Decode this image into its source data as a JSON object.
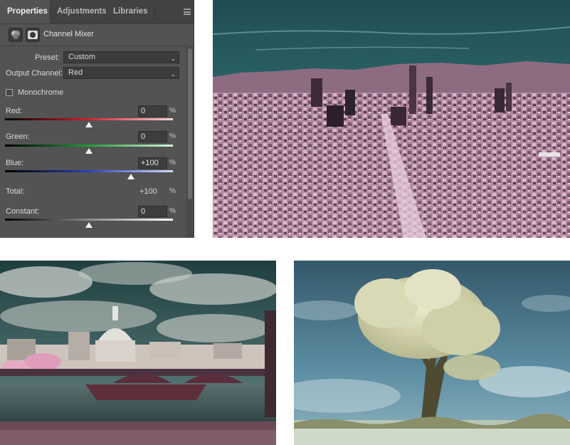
{
  "panel": {
    "tabs": [
      {
        "label": "Properties",
        "active": true
      },
      {
        "label": "Adjustments",
        "active": false
      },
      {
        "label": "Libraries",
        "active": false
      }
    ],
    "title": "Channel Mixer",
    "preset_label": "Preset:",
    "preset_value": "Custom",
    "output_channel_label": "Output Channel:",
    "output_channel_value": "Red",
    "monochrome_label": "Monochrome",
    "monochrome_checked": false,
    "sliders": [
      {
        "label": "Red:",
        "value": "0",
        "unit": "%",
        "level": 0
      },
      {
        "label": "Green:",
        "value": "0",
        "unit": "%",
        "level": 0
      },
      {
        "label": "Blue:",
        "value": "+100",
        "unit": "%",
        "level": 100
      }
    ],
    "total_label": "Total:",
    "total_value": "+100",
    "total_unit": "%",
    "constant": {
      "label": "Constant:",
      "value": "0",
      "unit": "%",
      "level": 0
    }
  },
  "photos": [
    {
      "name": "infrared-city-skyline",
      "palette": {
        "sky": "#2f6a6c",
        "city": "#b88aa3"
      }
    },
    {
      "name": "infrared-london-bridge",
      "palette": {
        "sky": "#3b6b6f",
        "water": "#3f5a5a"
      }
    },
    {
      "name": "infrared-tree",
      "palette": {
        "sky": "#4a7e93",
        "foliage": "#d4d6b4"
      }
    }
  ]
}
